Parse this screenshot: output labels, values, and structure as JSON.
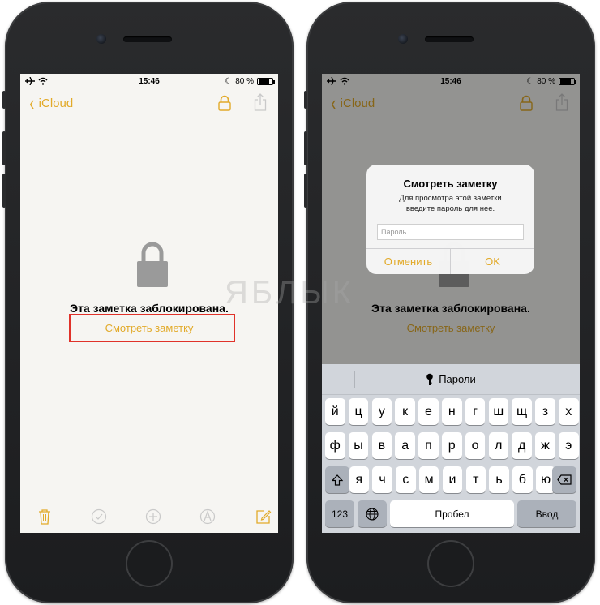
{
  "status": {
    "time": "15:46",
    "battery": "80 %",
    "battery_level": 0.8
  },
  "nav": {
    "back_label": "iCloud"
  },
  "note": {
    "locked_title": "Эта заметка заблокирована.",
    "view_label": "Смотреть заметку"
  },
  "alert": {
    "title": "Смотреть заметку",
    "message_line1": "Для просмотра этой заметки",
    "message_line2": "введите пароль для нее.",
    "password_placeholder": "Пароль",
    "cancel": "Отменить",
    "ok": "OK"
  },
  "keyboard": {
    "quicktype": "Пароли",
    "row1": [
      "й",
      "ц",
      "у",
      "к",
      "е",
      "н",
      "г",
      "ш",
      "щ",
      "з",
      "х"
    ],
    "row2": [
      "ф",
      "ы",
      "в",
      "а",
      "п",
      "р",
      "о",
      "л",
      "д",
      "ж",
      "э"
    ],
    "row3": [
      "я",
      "ч",
      "с",
      "м",
      "и",
      "т",
      "ь",
      "б",
      "ю"
    ],
    "numbers": "123",
    "space": "Пробел",
    "return": "Ввод"
  },
  "watermark": "ЯБЛЫК",
  "colors": {
    "accent": "#e2aa29",
    "highlight": "#e0322a",
    "note_bg": "#f6f5f2",
    "keyboard_bg": "#d1d5db"
  }
}
